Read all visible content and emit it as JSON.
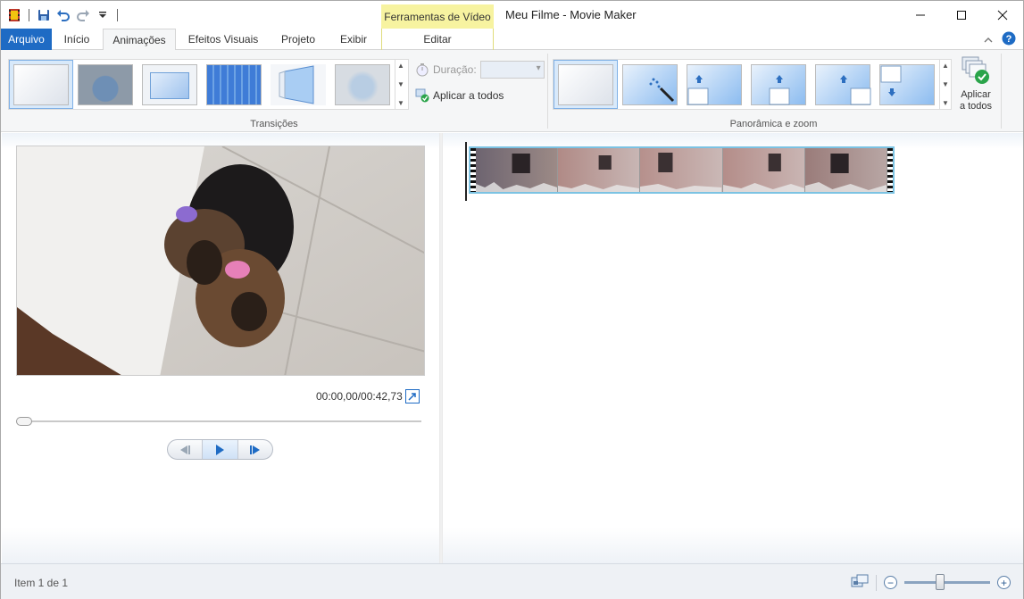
{
  "window": {
    "title": "Meu Filme - Movie Maker",
    "contextual_group": "Ferramentas de Vídeo"
  },
  "tabs": [
    {
      "label": "Arquivo"
    },
    {
      "label": "Início"
    },
    {
      "label": "Animações"
    },
    {
      "label": "Efeitos Visuais"
    },
    {
      "label": "Projeto"
    },
    {
      "label": "Exibir"
    },
    {
      "label": "Editar"
    }
  ],
  "ribbon": {
    "transitions": {
      "label": "Transições",
      "duration_label": "Duração:",
      "duration_value": "",
      "apply_all_label": "Aplicar a todos",
      "items": [
        "none",
        "crossfade",
        "zoom-box",
        "mosaic",
        "page-turn",
        "blur-fade"
      ]
    },
    "pan_zoom": {
      "label": "Panorâmica e zoom",
      "items": [
        "none",
        "auto-pan-zoom",
        "pan-up-left",
        "pan-up-center",
        "pan-up-right",
        "pan-down"
      ]
    },
    "big_apply_label_line1": "Aplicar",
    "big_apply_label_line2": "a todos"
  },
  "preview": {
    "timecode": "00:00,00/00:42,73",
    "progress": 0
  },
  "status": {
    "item_text": "Item 1 de 1",
    "zoom_level": 0.42
  },
  "colors": {
    "file_tab": "#1e6bc4",
    "context_tab": "#f7f3a0",
    "clip_border": "#7cc3e3"
  }
}
